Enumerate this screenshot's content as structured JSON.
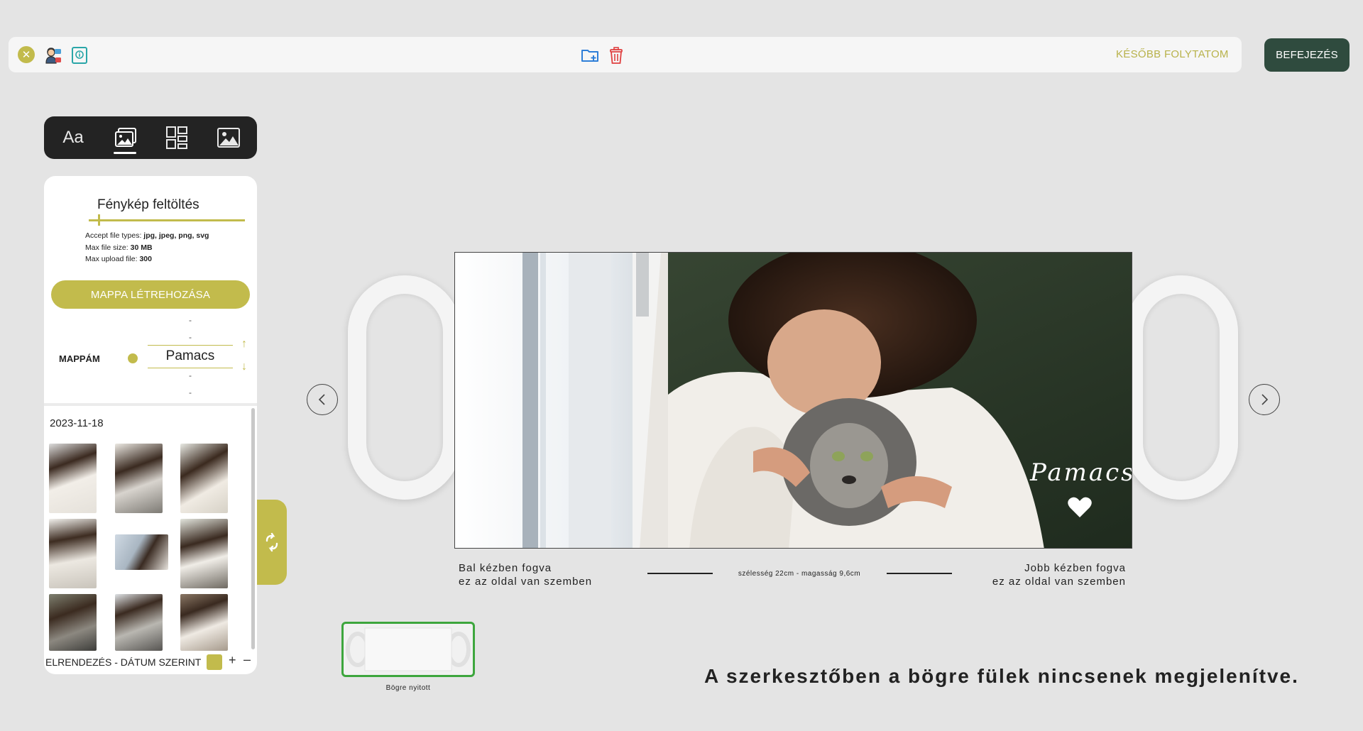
{
  "topbar": {
    "close_icon": "close-icon",
    "support_icon": "support-agent-icon",
    "info_icon": "info-book-icon",
    "folder_add_icon": "folder-add-icon",
    "trash_icon": "trash-icon",
    "later_label": "KÉSŐBB FOLYTATOM",
    "finish_label": "BEFEJEZÉS"
  },
  "tools": {
    "text_tab": "Aa",
    "photos_icon": "photos-icon",
    "layout_icon": "layout-grid-icon",
    "background_icon": "image-icon"
  },
  "upload": {
    "title": "Fénykép feltöltés",
    "accept_label": "Accept file types: ",
    "accept_value": "jpg, jpeg, png, svg",
    "size_label": "Max file size: ",
    "size_value": "30 MB",
    "count_label": "Max upload file: ",
    "count_value": "300",
    "create_folder_label": "MAPPA LÉTREHOZÁSA"
  },
  "folders": {
    "label": "MAPPÁM",
    "placeholder": "-",
    "current": "Pamacs"
  },
  "gallery": {
    "date": "2023-11-18"
  },
  "sort": {
    "label": "ELRENDEZÉS - DÁTUM SZERINT",
    "plus": "+",
    "minus": "–"
  },
  "editor": {
    "left_hold_line1": "Bal kézben fogva",
    "left_hold_line2": "ez az oldal van szemben",
    "right_hold_line1": "Jobb kézben fogva",
    "right_hold_line2": "ez az oldal van szemben",
    "dimensions": "szélesség 22cm - magasság 9,6cm",
    "overlay_text": "Pamacs",
    "variant_label": "Bögre nyitott",
    "notice": "A szerkesztőben a bögre fülek nincsenek megjelenítve."
  },
  "colors": {
    "accent": "#c2bb4c",
    "dark": "#232323",
    "finish": "#2f4b3e",
    "selected": "#3da63d"
  }
}
